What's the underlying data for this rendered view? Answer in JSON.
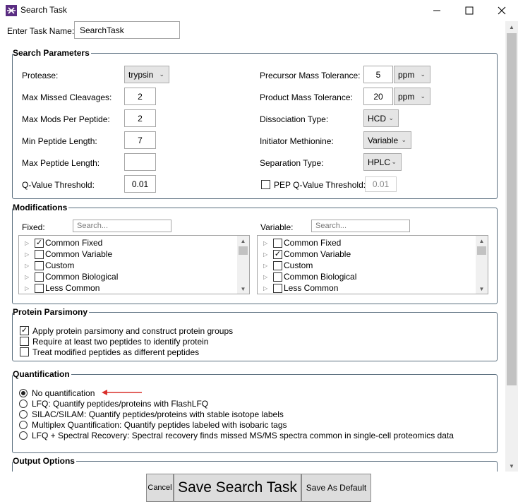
{
  "window": {
    "title": "Search Task",
    "minimize_glyph": "—",
    "maximize_glyph": "☐",
    "close_glyph": "✕"
  },
  "task_name": {
    "label": "Enter Task Name:",
    "value": "SearchTask"
  },
  "search_parameters": {
    "title": "Search Parameters",
    "protease": {
      "label": "Protease:",
      "value": "trypsin"
    },
    "max_missed_cleavages": {
      "label": "Max Missed Cleavages:",
      "value": "2"
    },
    "max_mods_per_peptide": {
      "label": "Max Mods Per Peptide:",
      "value": "2"
    },
    "min_peptide_length": {
      "label": "Min Peptide Length:",
      "value": "7"
    },
    "max_peptide_length": {
      "label": "Max Peptide Length:",
      "value": ""
    },
    "q_value_threshold": {
      "label": "Q-Value Threshold:",
      "value": "0.01"
    },
    "precursor_mass_tolerance": {
      "label": "Precursor Mass Tolerance:",
      "value": "5",
      "unit": "ppm"
    },
    "product_mass_tolerance": {
      "label": "Product Mass Tolerance:",
      "value": "20",
      "unit": "ppm"
    },
    "dissociation_type": {
      "label": "Dissociation Type:",
      "value": "HCD"
    },
    "initiator_methionine": {
      "label": "Initiator Methionine:",
      "value": "Variable"
    },
    "separation_type": {
      "label": "Separation Type:",
      "value": "HPLC"
    },
    "pep_q_value": {
      "label": "PEP Q-Value Threshold:",
      "value": "0.01",
      "checked": false
    }
  },
  "modifications": {
    "title": "Modifications",
    "fixed": {
      "label": "Fixed:",
      "search_placeholder": "Search...",
      "items": [
        {
          "label": "Common Fixed",
          "checked": true
        },
        {
          "label": "Common Variable",
          "checked": false
        },
        {
          "label": "Custom",
          "checked": false
        },
        {
          "label": "Common Biological",
          "checked": false
        },
        {
          "label": "Less Common",
          "checked": false
        }
      ]
    },
    "variable": {
      "label": "Variable:",
      "search_placeholder": "Search...",
      "items": [
        {
          "label": "Common Fixed",
          "checked": false
        },
        {
          "label": "Common Variable",
          "checked": true
        },
        {
          "label": "Custom",
          "checked": false
        },
        {
          "label": "Common Biological",
          "checked": false
        },
        {
          "label": "Less Common",
          "checked": false
        }
      ]
    }
  },
  "protein_parsimony": {
    "title": "Protein Parsimony",
    "options": [
      {
        "label": "Apply protein parsimony and construct protein groups",
        "checked": true
      },
      {
        "label": "Require at least two peptides to identify protein",
        "checked": false
      },
      {
        "label": "Treat modified peptides as different peptides",
        "checked": false
      }
    ]
  },
  "quantification": {
    "title": "Quantification",
    "options": [
      {
        "label": "No quantification",
        "selected": true
      },
      {
        "label": "LFQ: Quantify peptides/proteins with FlashLFQ",
        "selected": false
      },
      {
        "label": "SILAC/SILAM: Quantify peptides/proteins with stable isotope labels",
        "selected": false
      },
      {
        "label": "Multiplex Quantification: Quantify peptides labeled with isobaric tags",
        "selected": false
      },
      {
        "label": "LFQ + Spectral Recovery: Spectral recovery finds missed MS/MS spectra common in single-cell proteomics data",
        "selected": false
      }
    ],
    "annotation_arrow_color": "#d9302c"
  },
  "output_options": {
    "title": "Output Options"
  },
  "buttons": {
    "cancel": "Cancel",
    "save_search_task": "Save Search Task",
    "save_as_default": "Save As Default"
  },
  "icons": {
    "app": "app-logo-icon",
    "expander": "▷",
    "dropdown": "⌄",
    "check": "✓",
    "scroll_up": "▲",
    "scroll_down": "▼"
  }
}
